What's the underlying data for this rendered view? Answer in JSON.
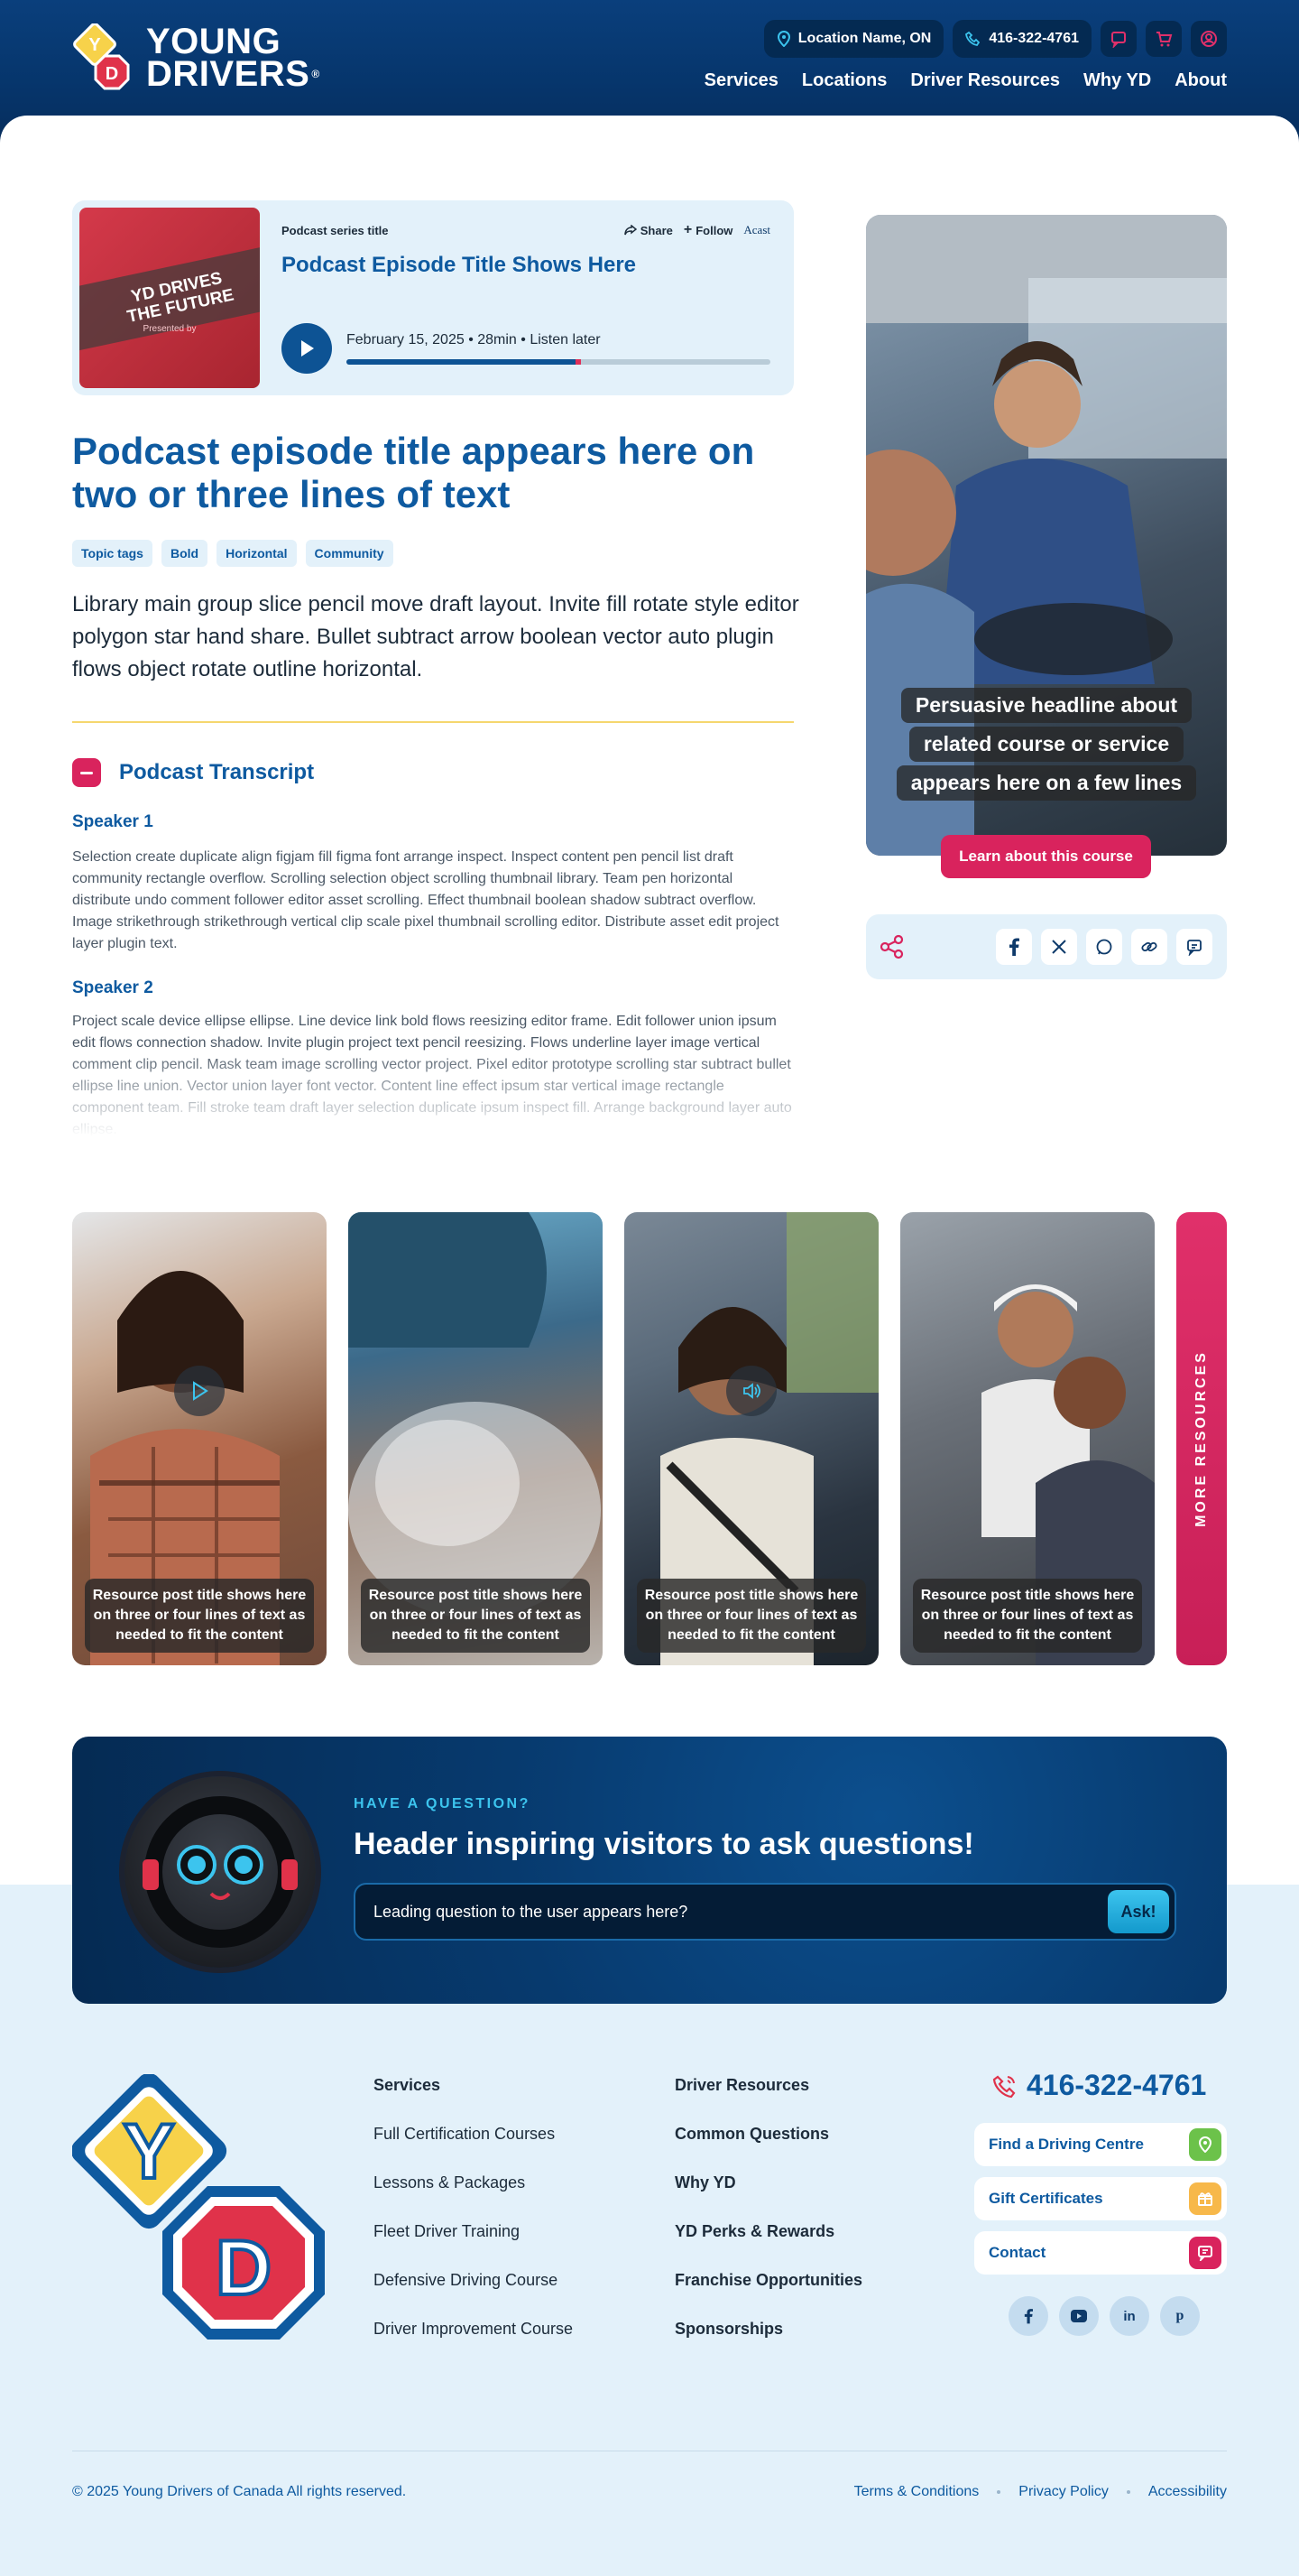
{
  "header": {
    "logo_line1": "YOUNG",
    "logo_line2": "DRIVERS",
    "location": "Location Name, ON",
    "phone": "416-322-4761",
    "nav": [
      "Services",
      "Locations",
      "Driver Resources",
      "Why YD",
      "About"
    ]
  },
  "player": {
    "cover_line1": "YD DRIVES",
    "cover_line2": "THE FUTURE",
    "cover_sub": "Presented by",
    "series": "Podcast series title",
    "title": "Podcast Episode Title Shows Here",
    "share": "Share",
    "follow": "Follow",
    "brand": "Acast",
    "meta": "February 15, 2025 • 28min • Listen later",
    "progress": 0.54
  },
  "article": {
    "title": "Podcast episode title appears here on two or three lines of text",
    "tags": [
      "Topic tags",
      "Bold",
      "Horizontal",
      "Community"
    ],
    "lead": "Library main group slice pencil move draft layout. Invite fill rotate style editor polygon star hand share. Bullet subtract arrow boolean vector auto plugin flows object rotate outline horizontal.",
    "transcript_title": "Podcast Transcript",
    "speakers": [
      {
        "name": "Speaker 1",
        "text": "Selection create duplicate align figjam fill figma font arrange inspect. Inspect content pen pencil list draft community rectangle overflow. Scrolling selection object scrolling thumbnail library. Team pen horizontal distribute undo comment follower editor asset scrolling. Effect thumbnail boolean shadow subtract overflow. Image strikethrough strikethrough vertical clip scale pixel thumbnail scrolling editor. Distribute asset edit project layer plugin text."
      },
      {
        "name": "Speaker 2",
        "text": "Project scale device ellipse ellipse. Line device link bold flows reesizing editor frame. Edit follower union ipsum edit flows connection shadow. Invite plugin project text pencil reesizing. Flows underline layer image vertical comment clip pencil. Mask team image scrolling vector project. Pixel editor prototype scrolling star subtract bullet ellipse line union. Vector union layer font vector. Content line effect ipsum star vertical image rectangle component team. Fill stroke team draft layer selection duplicate ipsum inspect fill. Arrange background layer auto ellipse."
      }
    ]
  },
  "promo": {
    "headline": [
      "Persuasive headline about",
      "related course or service",
      "appears here on a few lines"
    ],
    "button": "Learn about this course"
  },
  "cards": [
    {
      "caption": "Resource post title shows here on three or four lines of text as needed to fit the content",
      "icon": "play-icon"
    },
    {
      "caption": "Resource post title shows here on three or four lines of text as needed to fit the content",
      "icon": ""
    },
    {
      "caption": "Resource post title shows here on three or four lines of text as needed to fit the content",
      "icon": "audio-icon"
    },
    {
      "caption": "Resource post title shows here on three or four lines of text as needed to fit the content",
      "icon": ""
    }
  ],
  "more_resources": "MORE RESOURCES",
  "ask": {
    "kicker": "HAVE A QUESTION?",
    "title": "Header inspiring visitors to ask questions!",
    "placeholder": "Leading question to the user appears here?",
    "button": "Ask!"
  },
  "footer": {
    "col1": [
      "Services",
      "Full Certification Courses",
      "Lessons & Packages",
      "Fleet Driver Training",
      "Defensive Driving Course",
      "Driver Improvement Course"
    ],
    "col2": [
      "Driver Resources",
      "Common Questions",
      "Why YD",
      "YD Perks & Rewards",
      "Franchise Opportunities",
      "Sponsorships"
    ],
    "phone": "416-322-4761",
    "buttons": [
      "Find a Driving Centre",
      "Gift Certificates",
      "Contact"
    ],
    "copyright": "© 2025 Young Drivers of Canada All rights reserved.",
    "legal": [
      "Terms & Conditions",
      "Privacy Policy",
      "Accessibility"
    ]
  },
  "colors": {
    "brand_blue": "#0e5aa0",
    "navy": "#06356b",
    "pink": "#d9235d",
    "light": "#e3f1fa",
    "yellow": "#f5d76e"
  }
}
